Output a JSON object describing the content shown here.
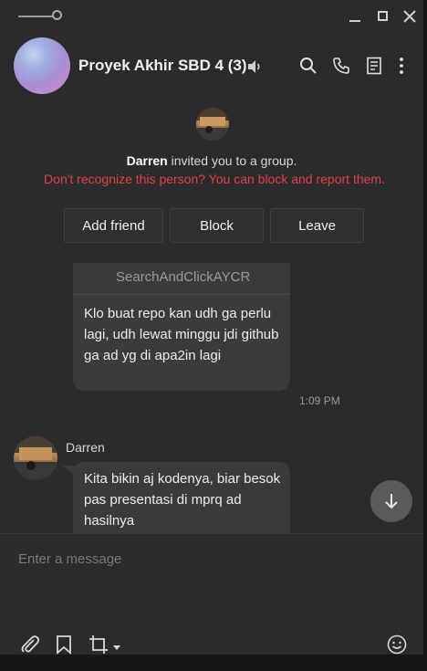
{
  "group": {
    "title": "Proyek Akhir SBD 4 (3)"
  },
  "invite": {
    "inviter": "Darren",
    "message": "invited you to a group.",
    "warning": "Don't recognize this person? You can block and report them.",
    "buttons": {
      "add_friend": "Add friend",
      "block": "Block",
      "leave": "Leave"
    }
  },
  "messages": [
    {
      "link": "ristek.link/\nSearchAndClickAYCR",
      "text": "Klo buat repo kan udh ga perlu lagi, udh lewat minggu jdi github ga ad yg di apa2in lagi",
      "time": "1:09 PM"
    },
    {
      "sender": "Darren",
      "text": "Kita bikin aj kodenya, biar besok pas presentasi di mprq ad hasilnya"
    }
  ],
  "composer": {
    "placeholder": "Enter a message"
  },
  "colors": {
    "background": "#2b2b2d",
    "bubble": "#3b3b3d",
    "warning": "#e5404a"
  },
  "icons": [
    "speaker-icon",
    "search-icon",
    "phone-icon",
    "notes-icon",
    "more-icon",
    "link-icon",
    "scroll-down-icon",
    "attach-icon",
    "bookmark-icon",
    "crop-icon",
    "emoji-icon"
  ]
}
